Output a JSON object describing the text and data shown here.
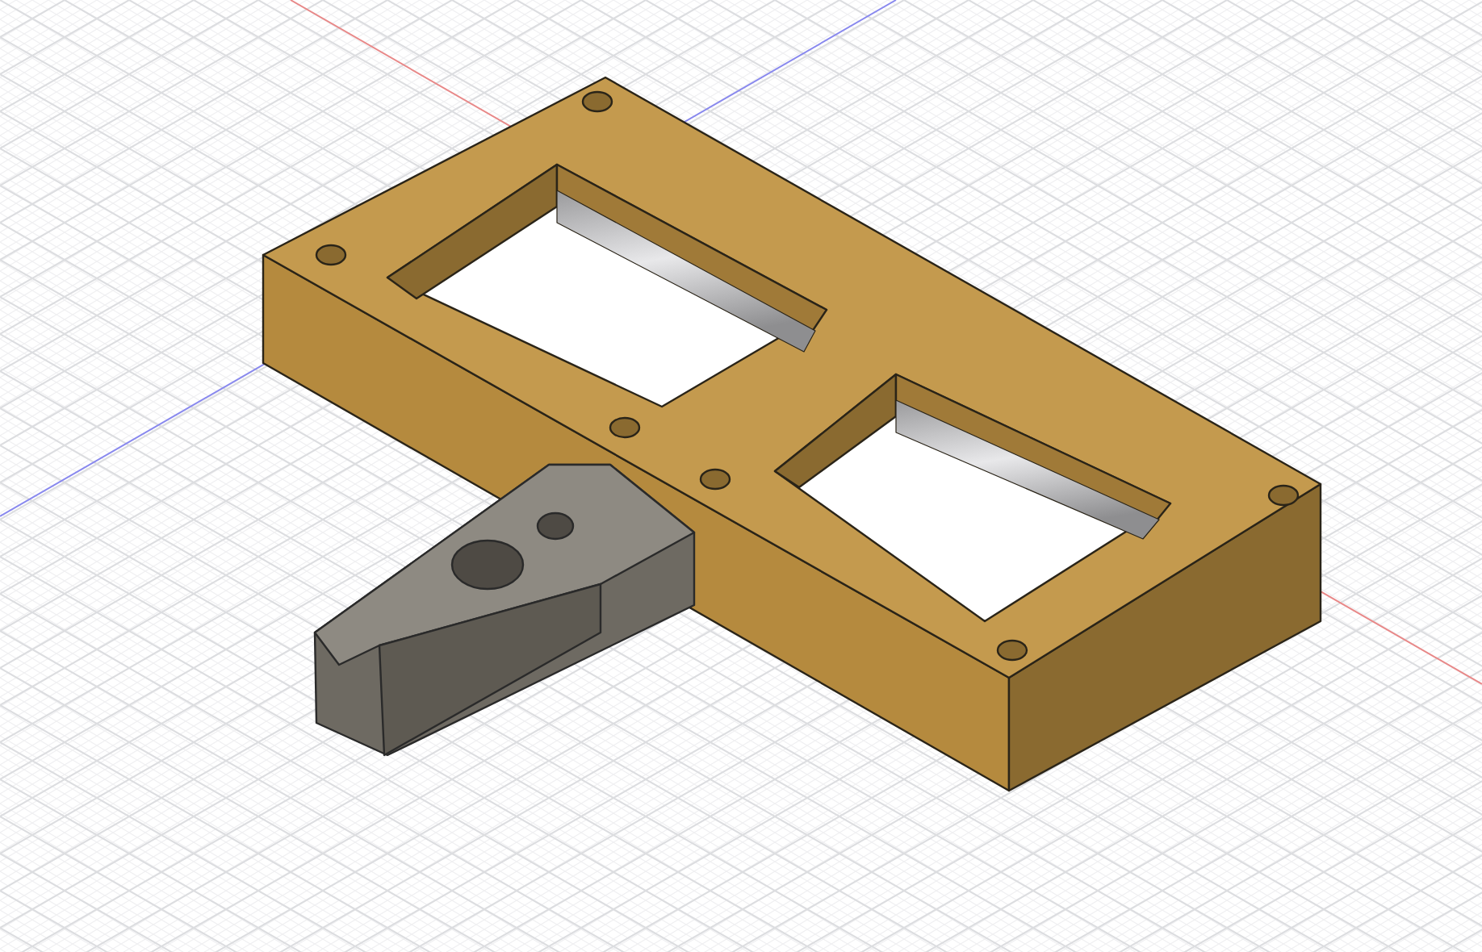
{
  "viewport": {
    "kind": "cad"
  }
}
